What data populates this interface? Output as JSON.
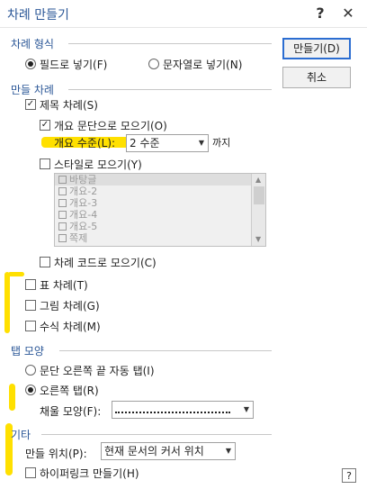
{
  "title": "차례 만들기",
  "title_buttons": {
    "help": "?",
    "close": "✕"
  },
  "buttons": {
    "create": "만들기(D)",
    "cancel": "취소"
  },
  "format_section": {
    "label": "차례 형식",
    "options": [
      {
        "label": "필드로 넣기(F)",
        "selected": true
      },
      {
        "label": "문자열로 넣기(N)",
        "selected": false
      }
    ]
  },
  "make_section": {
    "label": "만들 차례",
    "title_toc": {
      "label": "제목 차례(S)",
      "checked": true
    },
    "outline": {
      "label": "개요 문단으로 모으기(O)",
      "checked": true
    },
    "level": {
      "label": "개요 수준(L):",
      "value": "2 수준",
      "suffix": "까지"
    },
    "style": {
      "label": "스타일로 모으기(Y)",
      "checked": false
    },
    "style_list": [
      "바탕글",
      "개요-2",
      "개요-3",
      "개요-4",
      "개요-5",
      "쪽제"
    ],
    "code": {
      "label": "차례 코드로 모으기(C)",
      "checked": false
    },
    "table_toc": {
      "label": "표 차례(T)",
      "checked": false
    },
    "figure_toc": {
      "label": "그림 차례(G)",
      "checked": false
    },
    "equation_toc": {
      "label": "수식 차례(M)",
      "checked": false
    }
  },
  "tab_section": {
    "label": "탭 모양",
    "options": [
      {
        "label": "문단 오른쪽 끝 자동 탭(I)",
        "selected": false
      },
      {
        "label": "오른쪽 탭(R)",
        "selected": true
      }
    ],
    "fill": {
      "label": "채울 모양(F):"
    }
  },
  "other_section": {
    "label": "기타",
    "location": {
      "label": "만들 위치(P):",
      "value": "현재 문서의 커서 위치"
    },
    "hyperlink": {
      "label": "하이퍼링크 만들기(H)",
      "checked": false
    }
  },
  "help_icon": "?",
  "colors": {
    "accent": "#2b5797",
    "highlight": "#ffe600"
  }
}
